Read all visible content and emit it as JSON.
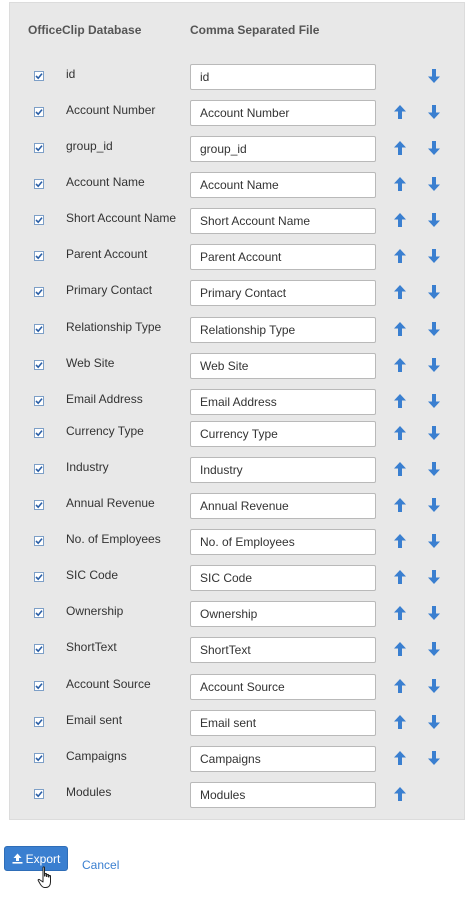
{
  "headers": {
    "database": "OfficeClip Database",
    "csv": "Comma Separated File"
  },
  "rows": [
    {
      "label": "id",
      "value": "id",
      "checked": true,
      "up": false,
      "down": true
    },
    {
      "label": "Account Number",
      "value": "Account Number",
      "checked": true,
      "up": true,
      "down": true
    },
    {
      "label": "group_id",
      "value": "group_id",
      "checked": true,
      "up": true,
      "down": true
    },
    {
      "label": "Account Name",
      "value": "Account Name",
      "checked": true,
      "up": true,
      "down": true
    },
    {
      "label": "Short Account Name",
      "value": "Short Account Name",
      "checked": true,
      "up": true,
      "down": true
    },
    {
      "label": "Parent Account",
      "value": "Parent Account",
      "checked": true,
      "up": true,
      "down": true
    },
    {
      "label": "Primary Contact",
      "value": "Primary Contact",
      "checked": true,
      "up": true,
      "down": true
    },
    {
      "label": "Relationship Type",
      "value": "Relationship Type",
      "checked": true,
      "up": true,
      "down": true
    },
    {
      "label": "Web Site",
      "value": "Web Site",
      "checked": true,
      "up": true,
      "down": true
    },
    {
      "label": "Email Address",
      "value": "Email Address",
      "checked": true,
      "up": true,
      "down": true
    },
    {
      "label": "Currency Type",
      "value": "Currency Type",
      "checked": true,
      "up": true,
      "down": true
    },
    {
      "label": "Industry",
      "value": "Industry",
      "checked": true,
      "up": true,
      "down": true
    },
    {
      "label": "Annual Revenue",
      "value": "Annual Revenue",
      "checked": true,
      "up": true,
      "down": true
    },
    {
      "label": "No. of Employees",
      "value": "No. of Employees",
      "checked": true,
      "up": true,
      "down": true
    },
    {
      "label": "SIC Code",
      "value": "SIC Code",
      "checked": true,
      "up": true,
      "down": true
    },
    {
      "label": "Ownership",
      "value": "Ownership",
      "checked": true,
      "up": true,
      "down": true
    },
    {
      "label": "ShortText",
      "value": "ShortText",
      "checked": true,
      "up": true,
      "down": true
    },
    {
      "label": "Account Source",
      "value": "Account Source",
      "checked": true,
      "up": true,
      "down": true
    },
    {
      "label": "Email sent",
      "value": "Email sent",
      "checked": true,
      "up": true,
      "down": true
    },
    {
      "label": "Campaigns",
      "value": "Campaigns",
      "checked": true,
      "up": true,
      "down": true
    },
    {
      "label": "Modules",
      "value": "Modules",
      "checked": true,
      "up": true,
      "down": false
    }
  ],
  "actions": {
    "export_label": "Export",
    "export_icon": "upload-icon",
    "cancel_label": "Cancel"
  },
  "colors": {
    "accent": "#3a7fd0",
    "panel_bg": "#e8e8e8",
    "checkbox_mark": "#2b5fa6"
  }
}
